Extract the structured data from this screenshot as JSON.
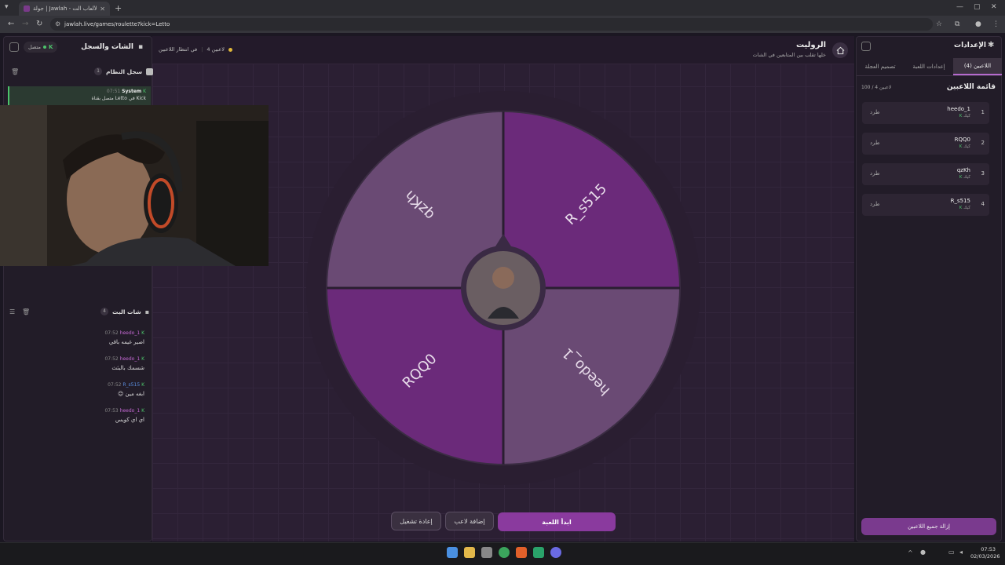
{
  "browser": {
    "tab_title": "جولة | Jawlah - منصة الألعاب الت...",
    "url": "jawlah.live/games/roulette?kick=Letto"
  },
  "left_panel": {
    "title": "الشات والسجل",
    "status": "متصل",
    "system_log": {
      "title": "سجل النظام",
      "count": "1",
      "entry_user": "System",
      "entry_time": "07:51",
      "entry_text": "متصل بقناة Letto في Kick"
    },
    "live_chat": {
      "title": "شات البث",
      "count": "4",
      "messages": [
        {
          "time": "07:52",
          "user": "heedo_1",
          "text": "اصير غيمه باقي"
        },
        {
          "time": "07:52",
          "user": "heedo_1",
          "text": "شسمك بالبثث"
        },
        {
          "time": "07:52",
          "user": "R_s515",
          "text": "😌 ابغه مين"
        },
        {
          "time": "07:53",
          "user": "heedo_1",
          "text": "اي اي كويس"
        }
      ]
    }
  },
  "header": {
    "title": "الروليت",
    "subtitle": "خلها تقلب بين المتابعين في الشات",
    "waiting": "في انتظار اللاعبين",
    "players_count": "4 لاعبين"
  },
  "wheel": {
    "slices": [
      {
        "label": "R_s515",
        "color": "#6b2a7a"
      },
      {
        "label": "heedo_1",
        "color": "#6a4a74"
      },
      {
        "label": "RQQ0",
        "color": "#6b2a7a"
      },
      {
        "label": "qzKh",
        "color": "#6a4a74"
      }
    ]
  },
  "controls": {
    "start": "ابدأ اللعبة",
    "add_player": "إضافة لاعب",
    "restart": "إعادة تشغيل"
  },
  "right_panel": {
    "title": "الإعدادات",
    "tabs": [
      "اللاعبين (4)",
      "إعدادات اللعبة",
      "تصميم العجلة"
    ],
    "list_title": "قائمة اللاعبين",
    "list_count": "100 / 4 لاعبين",
    "players": [
      {
        "num": "1",
        "name": "heedo_1",
        "platform": "كيك",
        "action": "طرد"
      },
      {
        "num": "2",
        "name": "RQQ0",
        "platform": "كيك",
        "action": "طرد"
      },
      {
        "num": "3",
        "name": "qzKh",
        "platform": "كيك",
        "action": "طرد"
      },
      {
        "num": "4",
        "name": "R_s515",
        "platform": "كيك",
        "action": "طرد"
      }
    ],
    "remove_all": "إزالة جميع اللاعبين"
  },
  "taskbar": {
    "time": "07:53",
    "date": "02/03/2026"
  },
  "colors": {
    "accent": "#9b3fb0",
    "kick_green": "#4cc36b"
  }
}
